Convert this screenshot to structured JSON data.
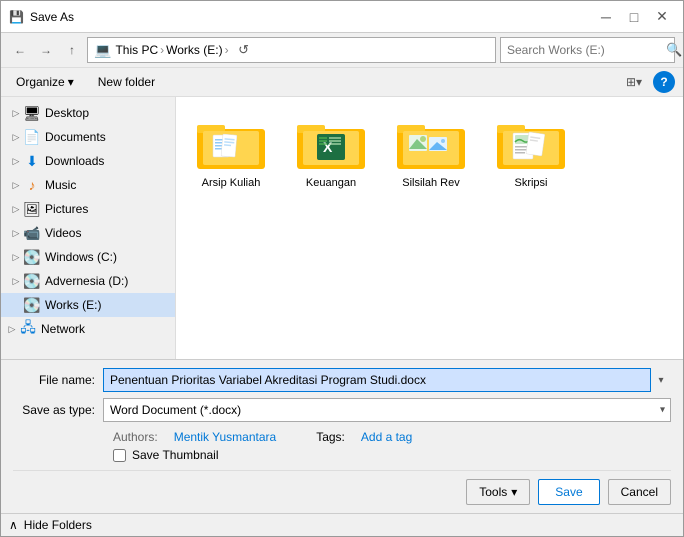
{
  "titleBar": {
    "icon": "💾",
    "title": "Save As",
    "closeLabel": "✕",
    "minLabel": "─",
    "maxLabel": "□"
  },
  "toolbar": {
    "backLabel": "←",
    "forwardLabel": "→",
    "upLabel": "↑",
    "breadcrumb": {
      "pc": "This PC",
      "sep1": "›",
      "drive": "Works (E:)",
      "sep2": "›"
    },
    "refreshLabel": "↺",
    "searchPlaceholder": "Search Works (E:)",
    "searchIconLabel": "🔍"
  },
  "secondToolbar": {
    "organizeLabel": "Organize",
    "organizeArrow": "▾",
    "newFolderLabel": "New folder",
    "viewArrow": "▾"
  },
  "sidebar": {
    "items": [
      {
        "id": "desktop",
        "label": "Desktop",
        "icon": "🖥",
        "indent": 1,
        "hasExpand": true,
        "active": false
      },
      {
        "id": "documents",
        "label": "Documents",
        "icon": "📄",
        "indent": 1,
        "hasExpand": true,
        "active": false
      },
      {
        "id": "downloads",
        "label": "Downloads",
        "icon": "⬇",
        "indent": 1,
        "hasExpand": true,
        "active": false
      },
      {
        "id": "music",
        "label": "Music",
        "icon": "♪",
        "indent": 1,
        "hasExpand": true,
        "active": false
      },
      {
        "id": "pictures",
        "label": "Pictures",
        "icon": "🖼",
        "indent": 1,
        "hasExpand": true,
        "active": false
      },
      {
        "id": "videos",
        "label": "Videos",
        "icon": "📹",
        "indent": 1,
        "hasExpand": true,
        "active": false
      },
      {
        "id": "windows-c",
        "label": "Windows (C:)",
        "icon": "💽",
        "indent": 1,
        "hasExpand": true,
        "active": false
      },
      {
        "id": "advernesia-d",
        "label": "Advernesia (D:)",
        "icon": "💽",
        "indent": 1,
        "hasExpand": true,
        "active": false
      },
      {
        "id": "works-e",
        "label": "Works (E:)",
        "icon": "💽",
        "indent": 1,
        "hasExpand": false,
        "active": true
      },
      {
        "id": "network",
        "label": "Network",
        "icon": "🖧",
        "indent": 0,
        "hasExpand": true,
        "active": false
      }
    ]
  },
  "folders": [
    {
      "id": "arsip-kuliah",
      "label": "Arsip Kuliah",
      "type": "docs"
    },
    {
      "id": "keuangan",
      "label": "Keuangan",
      "type": "excel"
    },
    {
      "id": "silsilah-rev",
      "label": "Silsilah Rev",
      "type": "images"
    },
    {
      "id": "skripsi",
      "label": "Skripsi",
      "type": "docs2"
    }
  ],
  "bottomPanel": {
    "fileNameLabel": "File name:",
    "fileNameValue": "Penentuan Prioritas Variabel Akreditasi Program Studi.docx",
    "saveAsTypeLabel": "Save as type:",
    "saveAsTypeValue": "Word Document (*.docx)",
    "authorsLabel": "Authors:",
    "authorsValue": "Mentik Yusmantara",
    "tagsLabel": "Tags:",
    "tagsValue": "Add a tag",
    "saveThumbnailLabel": "Save Thumbnail",
    "toolsLabel": "Tools",
    "toolsArrow": "▾",
    "saveLabel": "Save",
    "cancelLabel": "Cancel"
  },
  "hideFolders": {
    "arrowLabel": "∧",
    "label": "Hide Folders"
  }
}
